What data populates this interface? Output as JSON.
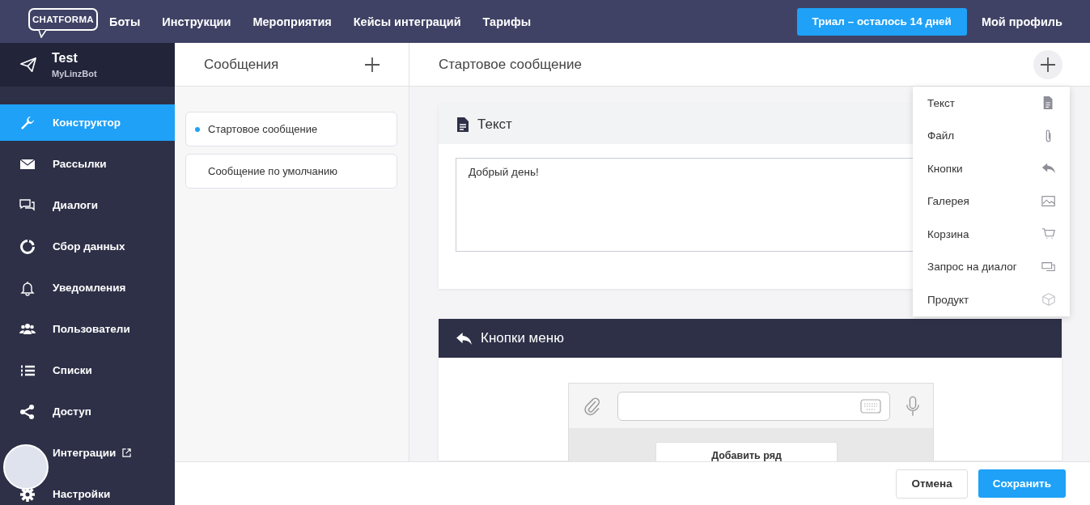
{
  "topnav": {
    "logo": "CHATFORMA",
    "links": [
      "Боты",
      "Инструкции",
      "Мероприятия",
      "Кейсы интеграций",
      "Тарифы"
    ],
    "trial_button": "Триал – осталось 14 дней",
    "profile_link": "Мой профиль"
  },
  "bot": {
    "name": "Test",
    "username": "MyLinzBot"
  },
  "sidebar": {
    "items": [
      {
        "label": "Конструктор",
        "selected": true,
        "external": false
      },
      {
        "label": "Рассылки",
        "selected": false,
        "external": false
      },
      {
        "label": "Диалоги",
        "selected": false,
        "external": false
      },
      {
        "label": "Сбор данных",
        "selected": false,
        "external": false
      },
      {
        "label": "Уведомления",
        "selected": false,
        "external": false
      },
      {
        "label": "Пользователи",
        "selected": false,
        "external": false
      },
      {
        "label": "Списки",
        "selected": false,
        "external": false
      },
      {
        "label": "Доступ",
        "selected": false,
        "external": false
      },
      {
        "label": "Интеграции",
        "selected": false,
        "external": true
      },
      {
        "label": "Настройки",
        "selected": false,
        "external": false
      }
    ]
  },
  "messages": {
    "title": "Сообщения",
    "items": [
      {
        "label": "Стартовое сообщение",
        "selected": true
      },
      {
        "label": "Сообщение по умолчанию",
        "selected": false
      }
    ]
  },
  "editor": {
    "title": "Стартовое сообщение",
    "add_menu": [
      "Текст",
      "Файл",
      "Кнопки",
      "Галерея",
      "Корзина",
      "Запрос на диалог",
      "Продукт"
    ],
    "text_block": {
      "title": "Текст",
      "value": "Добрый день!"
    },
    "buttons_block": {
      "title": "Кнопки меню",
      "add_row_button": "Добавить ряд"
    }
  },
  "footer": {
    "cancel_button": "Отмена",
    "save_button": "Сохранить"
  }
}
